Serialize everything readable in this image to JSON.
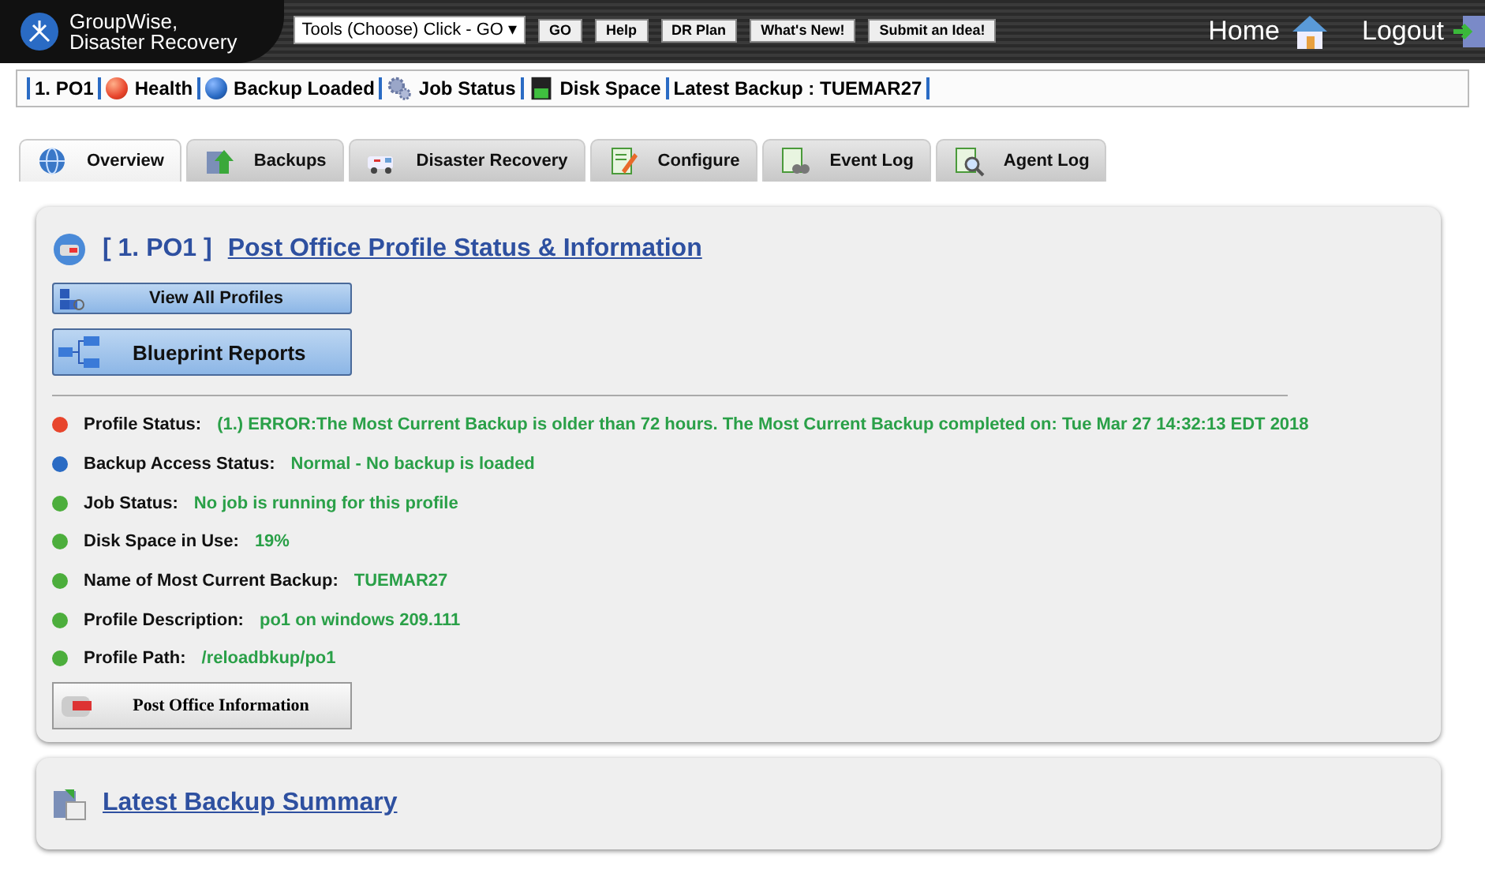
{
  "header": {
    "title_line1": "GroupWise,",
    "title_line2": "Disaster Recovery",
    "tools_select": "Tools (Choose) Click - GO ▾",
    "toolbar_buttons": [
      "GO",
      "Help",
      "DR Plan",
      "What's New!",
      "Submit an Idea!"
    ],
    "home": "Home",
    "logout": "Logout"
  },
  "status_strip": [
    {
      "kind": "text",
      "label": "1. PO1"
    },
    {
      "kind": "health",
      "label": "Health"
    },
    {
      "kind": "backup",
      "label": "Backup Loaded"
    },
    {
      "kind": "job",
      "label": "Job Status"
    },
    {
      "kind": "disk",
      "label": "Disk Space"
    },
    {
      "kind": "text",
      "label": "Latest Backup : TUEMAR27"
    }
  ],
  "tabs": [
    {
      "kind": "globe",
      "label": "Overview",
      "selected": true
    },
    {
      "kind": "backups",
      "label": "Backups",
      "selected": false
    },
    {
      "kind": "ambulance",
      "label": "Disaster Recovery",
      "selected": false
    },
    {
      "kind": "configure",
      "label": "Configure",
      "selected": false
    },
    {
      "kind": "eventlog",
      "label": "Event Log",
      "selected": false
    },
    {
      "kind": "agentlog",
      "label": "Agent Log",
      "selected": false
    }
  ],
  "profile_panel": {
    "prefix": "[ 1. PO1 ]",
    "title": "Post Office Profile Status & Information",
    "view_all_button": "View All Profiles",
    "blueprint_button": "Blueprint Reports",
    "status_rows": [
      {
        "label": "Profile Status:",
        "value": "(1.) ERROR:The Most Current Backup is older than 72 hours. The Most Current Backup completed on: Tue Mar 27 14:32:13 EDT 2018",
        "color": "#e8452c"
      },
      {
        "label": "Backup Access Status:",
        "value": "Normal - No backup is loaded",
        "color": "#2a6bc4"
      },
      {
        "label": "Job Status:",
        "value": "No job is running for this profile",
        "color": "#4cae3c"
      },
      {
        "label": "Disk Space in Use:",
        "value": "19%",
        "color": "#4cae3c"
      },
      {
        "label": "Name of Most Current Backup:",
        "value": "TUEMAR27",
        "color": "#4cae3c"
      },
      {
        "label": "Profile Description:",
        "value": "po1 on windows 209.111",
        "color": "#4cae3c"
      },
      {
        "label": "Profile Path:",
        "value": "/reloadbkup/po1",
        "color": "#4cae3c"
      }
    ],
    "info_button": "Post Office Information"
  },
  "summary_panel": {
    "title": "Latest Backup Summary"
  }
}
